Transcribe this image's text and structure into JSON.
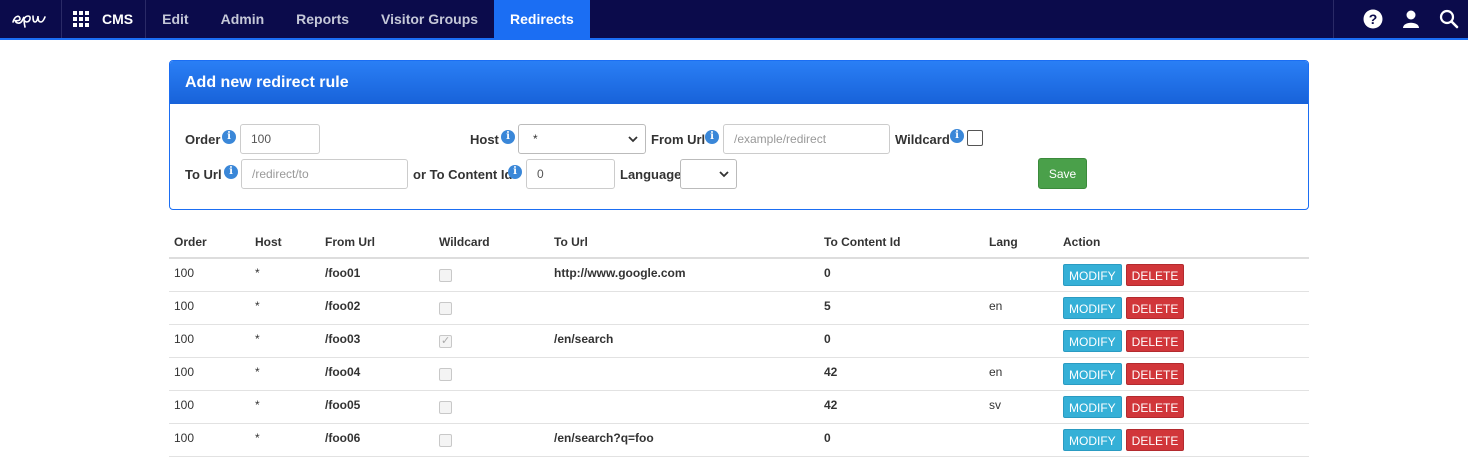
{
  "nav": {
    "app_name": "CMS",
    "tabs": [
      "Edit",
      "Admin",
      "Reports",
      "Visitor Groups",
      "Redirects"
    ],
    "active_tab": "Redirects"
  },
  "form": {
    "title": "Add new redirect rule",
    "order_label": "Order",
    "order_value": "100",
    "host_label": "Host",
    "host_value": "*",
    "from_url_label": "From Url",
    "from_url_placeholder": "/example/redirect",
    "wildcard_label": "Wildcard",
    "wildcard_checked": false,
    "to_url_label": "To Url",
    "to_url_placeholder": "/redirect/to",
    "to_content_label": "or To Content Id",
    "to_content_value": "0",
    "language_label": "Language",
    "language_value": "",
    "save_label": "Save"
  },
  "table": {
    "headers": [
      "Order",
      "Host",
      "From Url",
      "Wildcard",
      "To Url",
      "To Content Id",
      "Lang",
      "Action"
    ],
    "modify_label": "MODIFY",
    "delete_label": "DELETE",
    "rows": [
      {
        "order": "100",
        "host": "*",
        "from": "/foo01",
        "wildcard": false,
        "to": "http://www.google.com",
        "content": "0",
        "lang": ""
      },
      {
        "order": "100",
        "host": "*",
        "from": "/foo02",
        "wildcard": false,
        "to": "",
        "content": "5",
        "lang": "en"
      },
      {
        "order": "100",
        "host": "*",
        "from": "/foo03",
        "wildcard": true,
        "to": "/en/search",
        "content": "0",
        "lang": ""
      },
      {
        "order": "100",
        "host": "*",
        "from": "/foo04",
        "wildcard": false,
        "to": "",
        "content": "42",
        "lang": "en"
      },
      {
        "order": "100",
        "host": "*",
        "from": "/foo05",
        "wildcard": false,
        "to": "",
        "content": "42",
        "lang": "sv"
      },
      {
        "order": "100",
        "host": "*",
        "from": "/foo06",
        "wildcard": false,
        "to": "/en/search?q=foo",
        "content": "0",
        "lang": ""
      }
    ]
  },
  "colors": {
    "topbar": "#0b0b4b",
    "accent": "#1b6ef3",
    "modify": "#35b0d7",
    "delete": "#d1363a",
    "save": "#4aa04a"
  }
}
